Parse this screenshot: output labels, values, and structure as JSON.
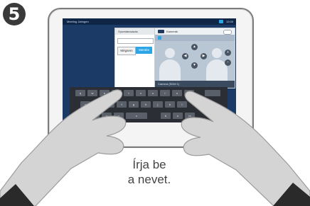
{
  "step_number": "5",
  "caption": {
    "line1": "Írja be",
    "line2": "a nevet."
  },
  "screen": {
    "user": "Meeting Jahngen",
    "time": "12:00",
    "name_panel": {
      "header": "Gyorstárcsázás",
      "cancel_label": "Mégsem",
      "save_label": "Mentés"
    },
    "camera_panel": {
      "header": "Kamerák",
      "footer": "Camera (SDM 1)"
    },
    "controls": {
      "up": "▲",
      "down": "▼",
      "left": "◀",
      "right": "▶",
      "zoom_in": "+",
      "zoom_out": "−"
    }
  },
  "keyboard": {
    "rows": [
      [
        "q",
        "w",
        "e",
        "r",
        "t",
        "z",
        "u",
        "i",
        "o",
        "p"
      ],
      [
        "a",
        "s",
        "d",
        "f",
        "g",
        "h",
        "j",
        "k",
        "l"
      ],
      [
        "y",
        "x",
        "c",
        "v",
        "b",
        "n",
        "m"
      ]
    ]
  },
  "colors": {
    "accent": "#2aa6e8",
    "screen_bg": "#1c3a66",
    "badge": "#3a3a3a"
  }
}
